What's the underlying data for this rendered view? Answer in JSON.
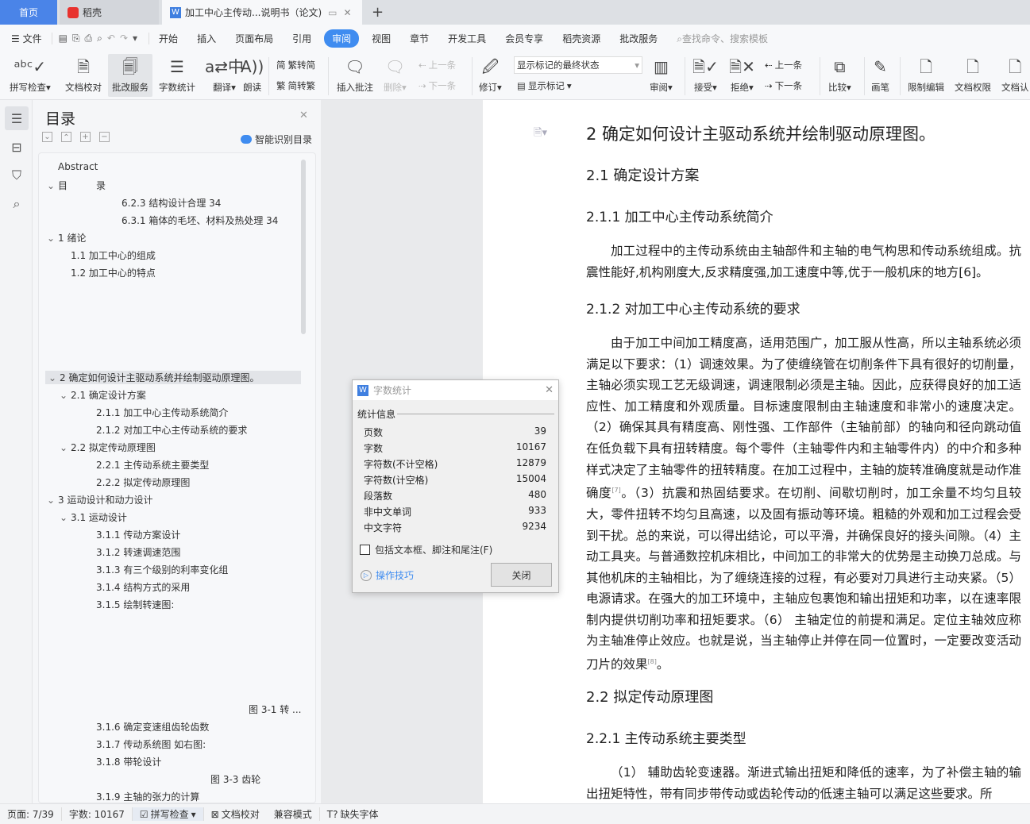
{
  "tabs": {
    "home": "首页",
    "docer": "稻壳",
    "doc": "加工中心主传动...说明书（论文)",
    "new": "+"
  },
  "menu": {
    "file": "文件",
    "items": [
      "开始",
      "插入",
      "页面布局",
      "引用",
      "审阅",
      "视图",
      "章节",
      "开发工具",
      "会员专享",
      "稻壳资源",
      "批改服务"
    ],
    "active": "审阅",
    "search": "查找命令、搜索模板"
  },
  "ribbon": {
    "spell": "拼写检查",
    "proof": "文档校对",
    "correct": "批改服务",
    "wordcount": "字数统计",
    "translate": "翻译",
    "read": "朗读",
    "t2s": "繁转简",
    "s2t": "简转繁",
    "insert_comment": "插入批注",
    "delete": "删除",
    "prev": "上一条",
    "next": "下一条",
    "revise": "修订",
    "markup_state": "显示标记的最终状态",
    "show_markup": "显示标记",
    "review": "审阅",
    "accept": "接受",
    "reject": "拒绝",
    "prev2": "上一条",
    "next2": "下一条",
    "compare": "比较",
    "pen": "画笔",
    "restrict": "限制编辑",
    "permission": "文档权限",
    "certify": "文档认"
  },
  "toc": {
    "title": "目录",
    "smart": "智能识别目录",
    "items": [
      {
        "label": "Abstract",
        "level": 0,
        "chev": false
      },
      {
        "label": "目　　　录",
        "level": 0,
        "chev": true
      },
      {
        "label": "6.2.3 结构设计合理  34",
        "level": 3,
        "chev": false
      },
      {
        "label": "6.3.1 箱体的毛坯、材料及热处理  34",
        "level": 3,
        "chev": false
      },
      {
        "label": "1 绪论",
        "level": 0,
        "chev": true
      },
      {
        "label": "1.1  加工中心的组成",
        "level": 1,
        "chev": false
      },
      {
        "label": "1.2  加工中心的特点",
        "level": 1,
        "chev": false
      },
      {
        "label": "2  确定如何设计主驱动系统并绘制驱动原理图。",
        "level": 0,
        "chev": true,
        "selected": true
      },
      {
        "label": "2.1  确定设计方案",
        "level": 1,
        "chev": true
      },
      {
        "label": "2.1.1 加工中心主传动系统简介",
        "level": 2,
        "chev": false
      },
      {
        "label": "2.1.2 对加工中心主传动系统的要求",
        "level": 2,
        "chev": false
      },
      {
        "label": "2.2 拟定传动原理图",
        "level": 1,
        "chev": true
      },
      {
        "label": "2.2.1 主传动系统主要类型",
        "level": 2,
        "chev": false
      },
      {
        "label": "2.2.2 拟定传动原理图",
        "level": 2,
        "chev": false
      },
      {
        "label": "3  运动设计和动力设计",
        "level": 0,
        "chev": true
      },
      {
        "label": "3.1  运动设计",
        "level": 1,
        "chev": true
      },
      {
        "label": "3.1.1  传动方案设计",
        "level": 2,
        "chev": false
      },
      {
        "label": "3.1.2 转速调速范围",
        "level": 2,
        "chev": false
      },
      {
        "label": "3.1.3 有三个级别的利率变化组",
        "level": 2,
        "chev": false
      },
      {
        "label": "3.1.4  结构方式的采用",
        "level": 2,
        "chev": false
      },
      {
        "label": "3.1.5  绘制转速图:",
        "level": 2,
        "chev": false
      },
      {
        "label": "图 3-1 转 ...",
        "level": 5,
        "chev": false
      },
      {
        "label": "3.1.6  确定变速组齿轮齿数",
        "level": 2,
        "chev": false
      },
      {
        "label": "3.1.7  传动系统图  如右图:",
        "level": 2,
        "chev": false
      },
      {
        "label": "3.1.8  带轮设计",
        "level": 2,
        "chev": false
      },
      {
        "label": "图 3-3 齿轮",
        "level": 4,
        "chev": false
      },
      {
        "label": "3.1.9  主轴的张力的计算",
        "level": 2,
        "chev": false
      }
    ]
  },
  "document": {
    "h1": "2  确定如何设计主驱动系统并绘制驱动原理图。",
    "h2_1": "2.1  确定设计方案",
    "h3_1": "2.1.1 加工中心主传动系统简介",
    "p1": "加工过程中的主传动系统由主轴部件和主轴的电气构思和传动系统组成。抗震性能好,机构刚度大,反求精度强,加工速度中等,优于一般机床的地方[6]。",
    "h3_2": "2.1.2 对加工中心主传动系统的要求",
    "p2a": "由于加工中间加工精度高，适用范围广，加工服从性高，所以主轴系统必须满足以下要求：（1）调速效果。为了使缠绕管在切削条件下具有很好的切削量，主轴必须实现工艺无级调速，调速限制必须是主轴。因此，应获得良好的加工适应性、加工精度和外观质量。目标速度限制由主轴速度和非常小的速度决定。（2）确保其具有精度高、刚性强、工作部件（主轴前部）的轴向和径向跳动值在低负载下具有扭转精度。每个零件（主轴零件内和主轴零件内）的中介和多种样式决定了主轴零件的扭转精度。在加工过程中，主轴的旋转准确度就是动作准确度",
    "ref7": "[7]",
    "p2b": "。（3）抗震和热固结要求。在切削、间歇切削时，加工余量不均匀且较大，零件扭转不均匀且高速，以及固有振动等环境。粗糙的外观和加工过程会受到干扰。总的来说，可以得出结论，可以平滑，并确保良好的接头间隙。（4）主动工具夹。与普通数控机床相比，中间加工的非常大的优势是主动换刀总成。与其他机床的主轴相比，为了缠绕连接的过程，有必要对刀具进行主动夹紧。（5）电源请求。在强大的加工环境中，主轴应包裹饱和输出扭矩和功率，以在速率限制内提供切削功率和扭矩要求。（6）  主轴定位的前提和满足。定位主轴效应称为主轴准停止效应。也就是说，当主轴停止并停在同一位置时，一定要改变活动刀片的效果",
    "ref8": "[8]",
    "p2c": "。",
    "h2_2": "2.2 拟定传动原理图",
    "h3_3": "2.2.1 主传动系统主要类型",
    "p3": "（1）  辅助齿轮变速器。渐进式输出扭矩和降低的速率，为了补偿主轴的输出扭矩特性，带有同步带传动或齿轮传动的低速主轴可以满足这些要求。所"
  },
  "dialog": {
    "title": "字数统计",
    "group": "统计信息",
    "rows": [
      {
        "label": "页数",
        "value": "39"
      },
      {
        "label": "字数",
        "value": "10167"
      },
      {
        "label": "字符数(不计空格)",
        "value": "12879"
      },
      {
        "label": "字符数(计空格)",
        "value": "15004"
      },
      {
        "label": "段落数",
        "value": "480"
      },
      {
        "label": "非中文单词",
        "value": "933"
      },
      {
        "label": "中文字符",
        "value": "9234"
      }
    ],
    "checkbox": "包括文本框、脚注和尾注(F)",
    "tips": "操作技巧",
    "close": "关闭"
  },
  "status": {
    "page": "页面: 7/39",
    "words": "字数: 10167",
    "spell": "拼写检查",
    "proof": "文档校对",
    "compat": "兼容模式",
    "font": "缺失字体"
  },
  "colors": {
    "accent": "#3f8cf0",
    "home_tab": "#4a84e8"
  }
}
